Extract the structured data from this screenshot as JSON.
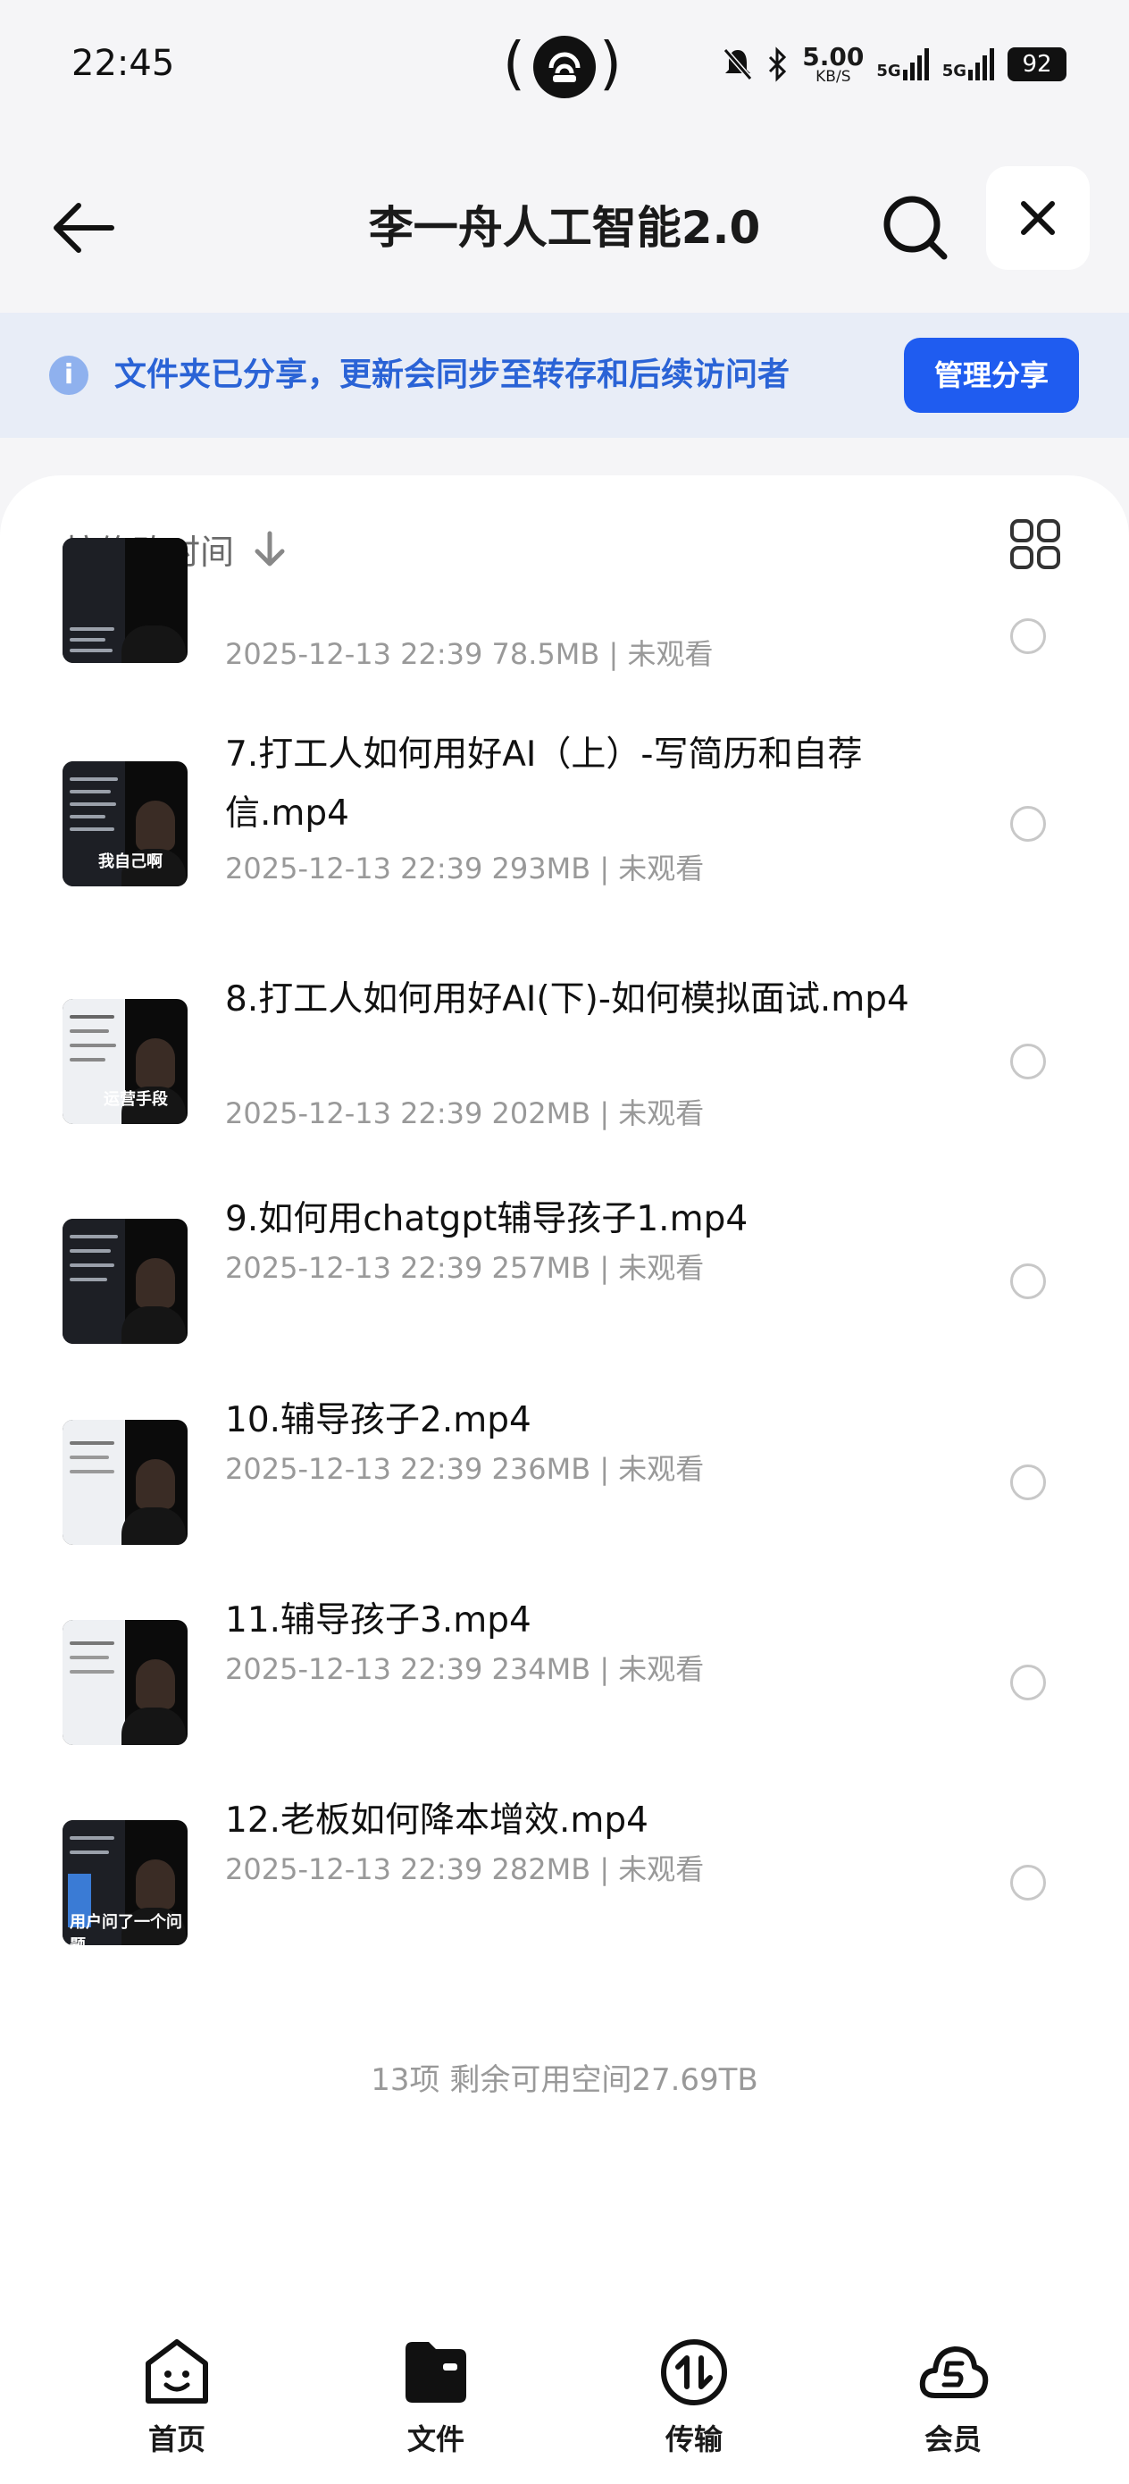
{
  "status_bar": {
    "time": "22:45",
    "net_speed_value": "5.00",
    "net_speed_unit": "KB/S",
    "signal_1": "5G",
    "signal_2": "5G",
    "battery": "92"
  },
  "header": {
    "title": "李一舟人工智能2.0"
  },
  "share_banner": {
    "text": "文件夹已分享，更新会同步至转存和后续访问者",
    "button_label": "管理分享"
  },
  "sort": {
    "label": "按修改时间"
  },
  "files": [
    {
      "name": "",
      "meta": "2025-12-13 22:39 78.5MB | 未观看"
    },
    {
      "name": "7.打工人如何用好AI（上）-写简历和自荐信.mp4",
      "meta": "2025-12-13 22:39 293MB | 未观看",
      "thumb_caption": "我自己啊"
    },
    {
      "name": "8.打工人如何用好AI(下)-如何模拟面试.mp4",
      "meta": "2025-12-13 22:39 202MB | 未观看",
      "thumb_caption": "运营手段"
    },
    {
      "name": "9.如何用chatgpt辅导孩子1.mp4",
      "meta": "2025-12-13 22:39 257MB | 未观看",
      "thumb_caption": ""
    },
    {
      "name": "10.辅导孩子2.mp4",
      "meta": "2025-12-13 22:39 236MB | 未观看",
      "thumb_caption": ""
    },
    {
      "name": "11.辅导孩子3.mp4",
      "meta": "2025-12-13 22:39 234MB | 未观看",
      "thumb_caption": ""
    },
    {
      "name": "12.老板如何降本增效.mp4",
      "meta": "2025-12-13 22:39 282MB | 未观看",
      "thumb_caption": "用户问了一个问题"
    }
  ],
  "footer": {
    "summary": "13项 剩余可用空间27.69TB"
  },
  "tabs": [
    {
      "label": "首页",
      "icon": "home-face-icon"
    },
    {
      "label": "文件",
      "icon": "folder-icon"
    },
    {
      "label": "传输",
      "icon": "transfer-icon"
    },
    {
      "label": "会员",
      "icon": "vip-cloud-icon"
    }
  ],
  "colors": {
    "accent": "#1f5cf0",
    "banner_bg": "#e8edf7",
    "banner_text": "#2a63d6"
  }
}
